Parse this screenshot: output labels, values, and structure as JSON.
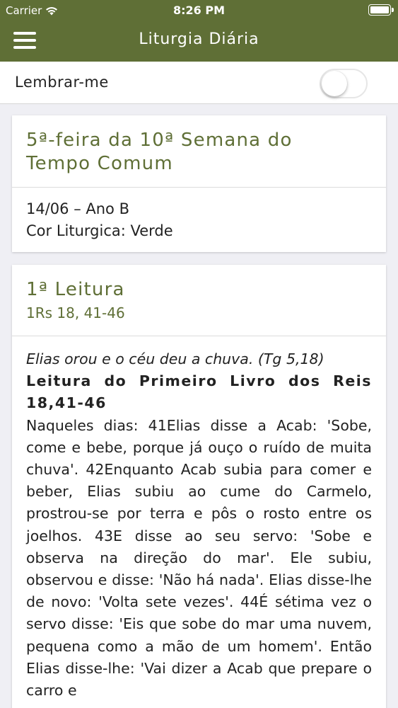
{
  "status": {
    "carrier": "Carrier",
    "time": "8:26 PM"
  },
  "header": {
    "title": "Liturgia Diária"
  },
  "reminder": {
    "label": "Lembrar-me",
    "enabled": false
  },
  "day": {
    "title_line1": "5ª-feira da 10ª Semana do",
    "title_line2": "Tempo Comum",
    "date_line": "14/06 – Ano B",
    "color_line": "Cor Liturgica: Verde"
  },
  "reading": {
    "title": "1ª Leitura",
    "reference": "1Rs 18, 41-46",
    "intro": "Elias orou e o céu deu a chuva. (Tg 5,18)",
    "book": "Leitura do Primeiro Livro dos Reis 18,41-46",
    "text": "Naqueles dias: 41Elias disse a Acab: 'Sobe, come e bebe, porque já ouço o ruído de muita chuva'. 42Enquanto Acab subia para comer e beber, Elias subiu ao cume do Carmelo, prostrou-se por terra e pôs o rosto entre os joelhos. 43E disse ao seu servo: 'Sobe e observa na direção do mar'. Ele subiu, observou e disse: 'Não há nada'. Elias disse-lhe de novo: 'Volta sete vezes'. 44É sétima vez o servo disse: 'Eis que sobe do mar uma nuvem, pequena como a mão de um homem'. Então Elias disse-lhe: 'Vai dizer a Acab que prepare o carro e"
  },
  "colors": {
    "header": "#5f6f36",
    "accent": "#5f6f36",
    "background": "#efeff4"
  },
  "icons": [
    "wifi-icon",
    "battery-icon",
    "menu-icon"
  ]
}
